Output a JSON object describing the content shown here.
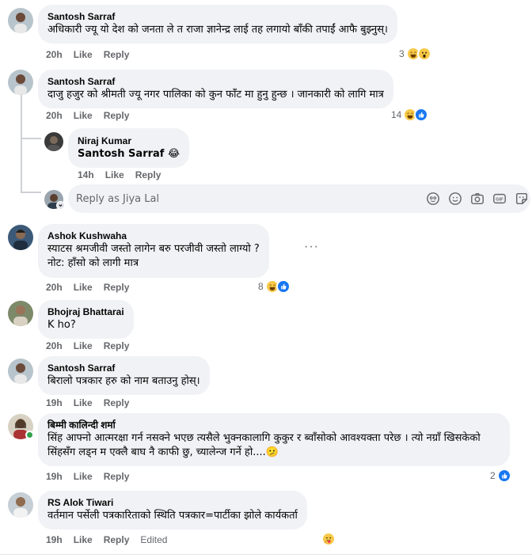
{
  "labels": {
    "like": "Like",
    "reply": "Reply"
  },
  "comments": [
    {
      "author": "Santosh Sarraf",
      "text": "अधिकारी ज्यू यो देश को जनता ले त राजा ज्ञानेन्द्र लाई तह लगायो बाँकी तपाईं आफै बुझ्नुस्।",
      "time": "20h",
      "reaction_count": "3",
      "reactions": [
        "haha",
        "wow"
      ]
    },
    {
      "author": "Santosh Sarraf",
      "text": "दाजु हजुर को श्रीमती ज्यू नगर पालिका को कुन फाँट मा हुनु हुन्छ । जानकारी को लागि मात्र",
      "time": "20h",
      "reaction_count": "14",
      "reactions": [
        "haha",
        "like"
      ]
    },
    {
      "author": "Niraj Kumar",
      "text": "Santosh Sarraf 😂",
      "time": "14h"
    },
    {
      "author": "Ashok Kushwaha",
      "text": "स्याटस श्रमजीवी जस्तो लागेन बरु परजीवी जस्तो लाग्यो ?\nनोट: हाँसो को लागी मात्र",
      "time": "20h",
      "reaction_count": "8",
      "reactions": [
        "haha",
        "like"
      ],
      "more_label": "···"
    },
    {
      "author": "Bhojraj Bhattarai",
      "text": "K ho?",
      "time": "20h"
    },
    {
      "author": "Santosh Sarraf",
      "text": "बिरालो पत्रकार हरु को नाम बताउनु होस्।",
      "time": "19h"
    },
    {
      "author": "बिम्मी कालिन्दी शर्मा",
      "text": "सिंह आफ्नो आत्मरक्षा गर्न नसक्ने भएछ त्यसैले भुक्नकालागि कुकुर र ब्वाँसोको आवश्यक्ता परेछ । त्यो नग्राँ खिसकेको सिंहसँग लड्न म एक्लै बाघ नै काफी छु, च्यालेन्ज गर्ने हो....🫤",
      "time": "19h",
      "reaction_count": "2",
      "reactions": [
        "like"
      ]
    },
    {
      "author": "RS Alok Tiwari",
      "text": "वर्तमान पर्सेली पत्रकारिताको स्थिति पत्रकार=पार्टीका झोले कार्यकर्ता",
      "time": "19h",
      "edited": "Edited",
      "reactions": [
        "care"
      ]
    }
  ],
  "reply_box": {
    "placeholder": "Reply as Jiya Lal"
  },
  "colors": {
    "bubble": "#f0f2f5",
    "meta": "#65676b",
    "like_blue": "#1877f2",
    "online_green": "#31a24c"
  },
  "icons": [
    "avatar-icon-face",
    "sticker-icon",
    "smiley-icon",
    "camera-icon",
    "gif-icon",
    "sticker-2-icon"
  ]
}
